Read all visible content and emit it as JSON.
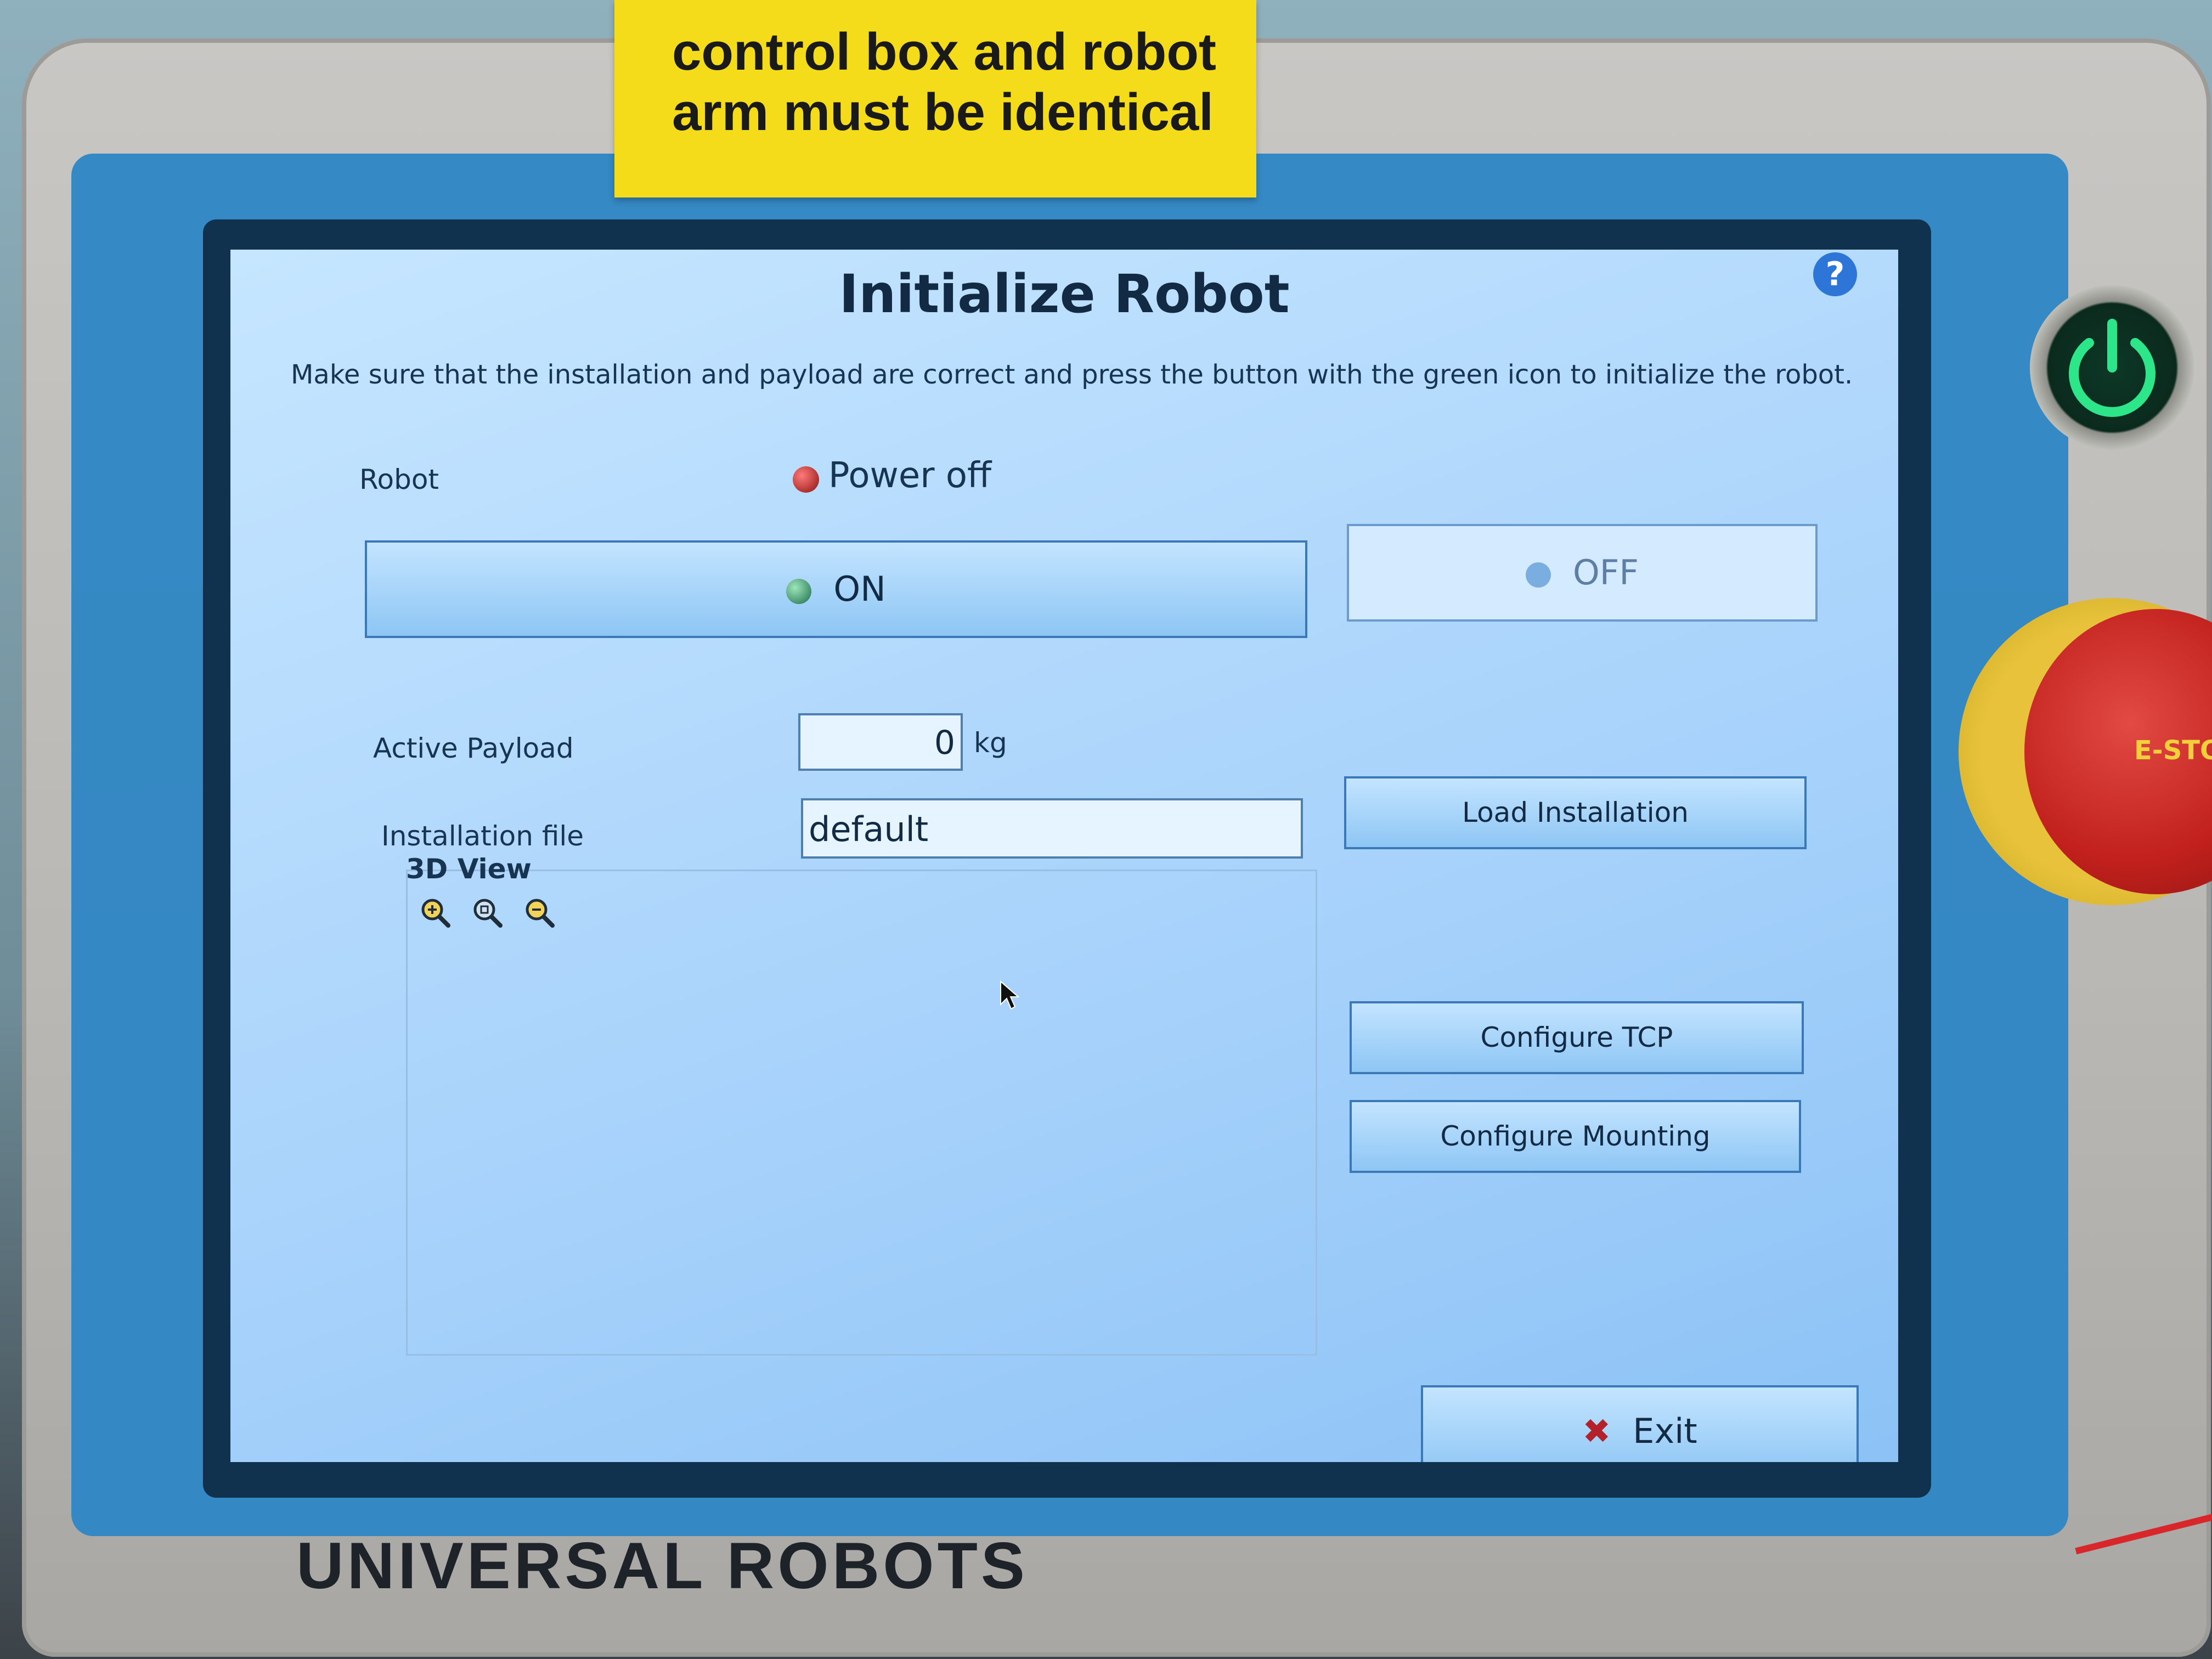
{
  "sticker": {
    "line1": "control box and robot",
    "line2": "arm must be identical"
  },
  "dialog": {
    "title": "Initialize Robot",
    "help_glyph": "?",
    "description": "Make sure that the installation and payload are correct and press the button with the green icon to initialize the robot."
  },
  "robot": {
    "label": "Robot",
    "status": "Power off",
    "status_color": "#b3232a"
  },
  "buttons": {
    "on": "ON",
    "off": "OFF",
    "load_installation": "Load Installation",
    "configure_tcp": "Configure TCP",
    "configure_mounting": "Configure Mounting",
    "exit": "Exit"
  },
  "payload": {
    "label": "Active Payload",
    "value": "0",
    "unit": "kg"
  },
  "installation": {
    "label": "Installation file",
    "value": "default"
  },
  "view3d": {
    "label": "3D View",
    "icons": [
      "zoom-in-icon",
      "zoom-reset-icon",
      "zoom-out-icon"
    ]
  },
  "hardware": {
    "estop_label": "E-STO",
    "brand": "UNIVERSAL ROBOTS"
  },
  "colors": {
    "accent": "#2f86c4",
    "power_on_glow": "#2ee68a"
  }
}
